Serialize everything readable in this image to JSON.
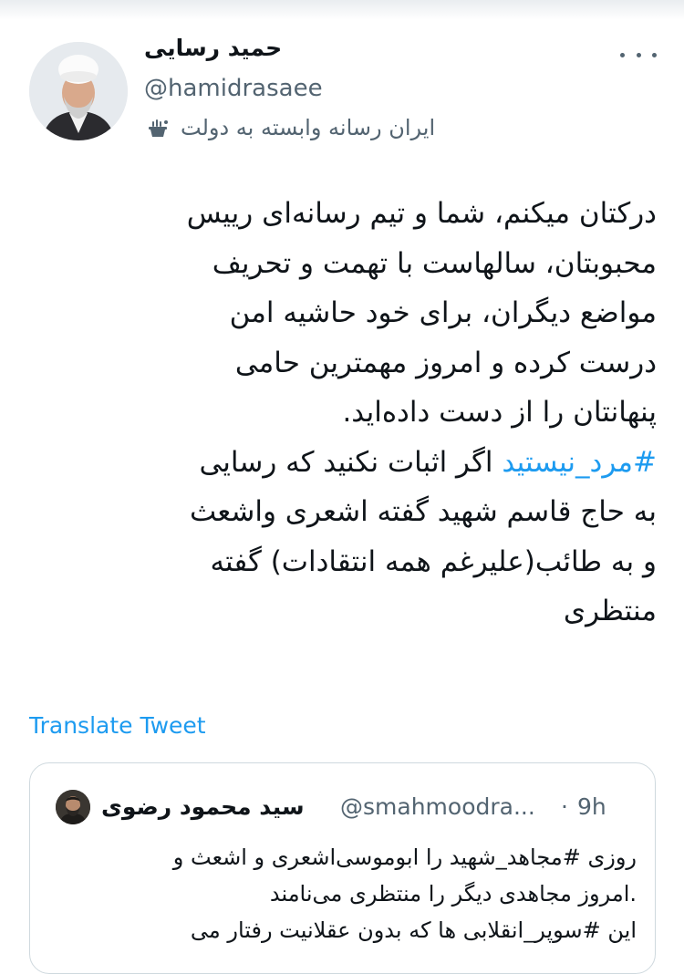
{
  "author": {
    "name": "حمید رسایی",
    "handle": "@hamidrasaee",
    "label": "ایران رسانه وابسته به دولت",
    "label_icon": "state-affiliated-media-icon",
    "avatar_icon": "profile-photo"
  },
  "tweet": {
    "lines": [
      "درکتان میکنم، شما و تیم رسانه‌ای رییس",
      "محبوبتان، سالهاست با تهمت و تحریف",
      "مواضع دیگران، برای خود حاشیه امن",
      "درست کرده و امروز مهمترین حامی",
      "پنهانتان را از دست داده‌اید."
    ],
    "hashtag": "#مرد_نیستید",
    "hashtag_line_rest": " اگر اثبات نکنید که رسایی",
    "lines_after": [
      "به حاج قاسم شهید گفته اشعری واشعث",
      "و به طائب(علیرغم همه انتقادات) گفته",
      "منتظری"
    ]
  },
  "translate_label": "Translate Tweet",
  "quoted": {
    "name": "سید محمود رضوی",
    "handle": "@smahmoodra...",
    "separator": "·",
    "time": "9h",
    "lines": [
      "روزی #مجاهد_شهید را ابوموسی‌اشعری و اشعث و",
      ".امروز مجاهدی دیگر را منتظری می‌نامند",
      "این #سوپر_انقلابی ها که بدون عقلانیت رفتار می"
    ]
  },
  "colors": {
    "accent": "#1d9bf0",
    "text": "#0f1419",
    "secondary": "#536471",
    "border": "#cfd9de"
  }
}
